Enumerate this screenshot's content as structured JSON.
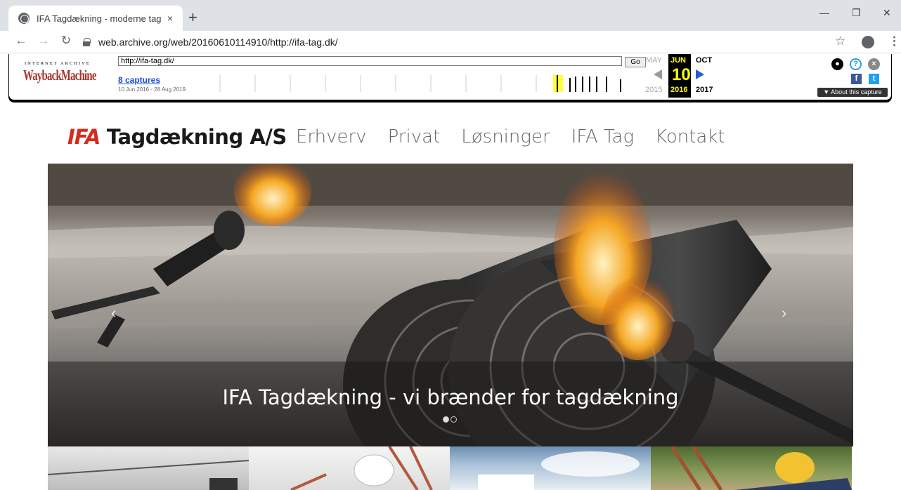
{
  "browser": {
    "tab_title": "IFA Tagdækning - moderne tag",
    "tab_close": "×",
    "new_tab": "+",
    "url": "web.archive.org/web/20160610114910/http://ifa-tag.dk/",
    "window_controls": [
      "—",
      "❐",
      "✕"
    ]
  },
  "wayback": {
    "logo_top": "INTERNET ARCHIVE",
    "logo_main": "WaybackMachine",
    "url_input": "http://ifa-tag.dk/",
    "go": "Go",
    "captures": "8 captures",
    "date_range": "10 Jun 2016 - 28 Aug 2019",
    "prev_month": "MAY",
    "cur_month": "JUN",
    "next_month": "OCT",
    "cur_day": "10",
    "prev_year": "2015",
    "cur_year": "2016",
    "next_year": "2017",
    "about": "▼ About this capture"
  },
  "site": {
    "logo_ifa": "IFA",
    "logo_text": "Tagdækning A/S",
    "nav": [
      "Erhverv",
      "Privat",
      "Løsninger",
      "IFA Tag",
      "Kontakt"
    ],
    "hero_caption": "IFA Tagdækning - vi brænder for tagdækning"
  },
  "colors": {
    "brand_red": "#d52b1e",
    "wayback_yellow": "#ffff00",
    "link_blue": "#1a4bd3"
  }
}
